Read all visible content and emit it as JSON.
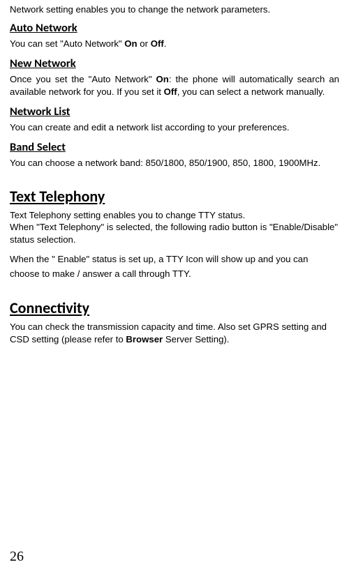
{
  "intro": "Network setting enables you to change the network parameters.",
  "sections": {
    "autoNetwork": {
      "heading": "Auto Network",
      "pre1": "You can set \"Auto Network\" ",
      "b1": "On",
      "mid1": " or ",
      "b2": "Off",
      "post1": "."
    },
    "newNetwork": {
      "heading": "New Network",
      "pre1": "Once you set the \"Auto Network\" ",
      "b1": "On",
      "mid1": ": the phone will automatically search an available network for you. If you set it ",
      "b2": "Off",
      "post1": ", you can select a network manually."
    },
    "networkList": {
      "heading": "Network List",
      "body": "You can create and edit a network list according to your preferences."
    },
    "bandSelect": {
      "heading": "Band Select",
      "body": "You can choose a network band: 850/1800, 850/1900, 850, 1800, 1900MHz."
    },
    "textTelephony": {
      "heading": "Text Telephony",
      "body1": "Text Telephony setting enables you to change TTY status.\nWhen \"Text Telephony\" is selected, the following radio button is \"Enable/Disable\" status selection.",
      "body2": "When the \" Enable\"  status is set up, a TTY Icon will show up and you can choose to make / answer a call through TTY."
    },
    "connectivity": {
      "heading": "Connectivity",
      "pre1": "You can check the transmission capacity and time. Also set GPRS setting and CSD setting (please refer to ",
      "b1": "Browser",
      "post1": " Server Setting)."
    }
  },
  "pageNumber": "26"
}
